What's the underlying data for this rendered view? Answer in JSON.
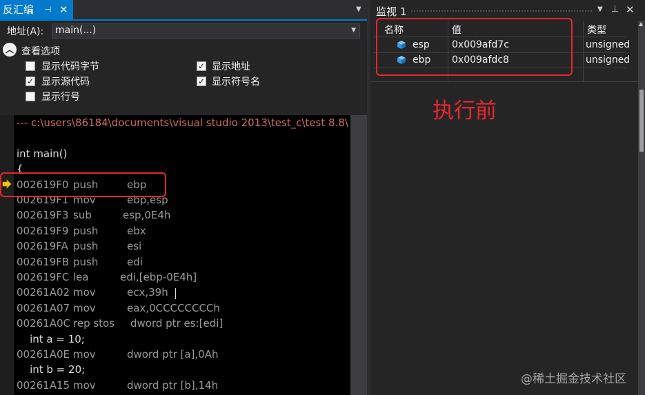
{
  "left_panel": {
    "tab_title": "反汇编",
    "pin_glyph": "⊣",
    "close_glyph": "✕",
    "address_label": "地址(A):",
    "address_value": "main(...)",
    "options_title": "查看选项",
    "options": [
      {
        "label": "显示代码字节",
        "checked": false
      },
      {
        "label": "显示地址",
        "checked": true
      },
      {
        "label": "显示源代码",
        "checked": true
      },
      {
        "label": "显示符号名",
        "checked": true
      },
      {
        "label": "显示行号",
        "checked": false
      }
    ]
  },
  "code": {
    "header_comment": "--- c:\\users\\86184\\documents\\visual studio 2013\\test_c\\test 8.8\\",
    "lines": [
      {
        "type": "blank",
        "text": ""
      },
      {
        "type": "src",
        "text": "int main()"
      },
      {
        "type": "src",
        "text": "{"
      },
      {
        "type": "asm",
        "addr": "002619F0",
        "op": "push",
        "args": "ebp"
      },
      {
        "type": "asm",
        "addr": "002619F1",
        "op": "mov",
        "args": "ebp,esp"
      },
      {
        "type": "asm",
        "addr": "002619F3",
        "op": "sub",
        "args": "esp,0E4h"
      },
      {
        "type": "asm",
        "addr": "002619F9",
        "op": "push",
        "args": "ebx"
      },
      {
        "type": "asm",
        "addr": "002619FA",
        "op": "push",
        "args": "esi"
      },
      {
        "type": "asm",
        "addr": "002619FB",
        "op": "push",
        "args": "edi"
      },
      {
        "type": "asm",
        "addr": "002619FC",
        "op": "lea",
        "args": "edi,[ebp-0E4h]"
      },
      {
        "type": "asm",
        "addr": "00261A02",
        "op": "mov",
        "args": "ecx,39h"
      },
      {
        "type": "asm",
        "addr": "00261A07",
        "op": "mov",
        "args": "eax,0CCCCCCCCh"
      },
      {
        "type": "asm",
        "addr": "00261A0C",
        "op": "rep stos",
        "args": "dword ptr es:[edi]"
      },
      {
        "type": "src",
        "text": "    int a = 10;"
      },
      {
        "type": "asm",
        "addr": "00261A0E",
        "op": "mov",
        "args": "dword ptr [a],0Ah"
      },
      {
        "type": "src",
        "text": "    int b = 20;"
      },
      {
        "type": "asm",
        "addr": "00261A15",
        "op": "mov",
        "args": "dword ptr [b],14h"
      }
    ]
  },
  "watch_panel": {
    "title": "监视 1",
    "columns": [
      "名称",
      "值",
      "类型"
    ],
    "rows": [
      {
        "name": "esp",
        "value": "0x009afd7c",
        "type": "unsigned"
      },
      {
        "name": "ebp",
        "value": "0x009afdc8",
        "type": "unsigned"
      }
    ]
  },
  "annotation": "执行前",
  "watermark": "@稀土掘金技术社区",
  "colors": {
    "accent": "#007acc",
    "highlight_box": "#e8262b",
    "arrow": "#f2c811"
  }
}
